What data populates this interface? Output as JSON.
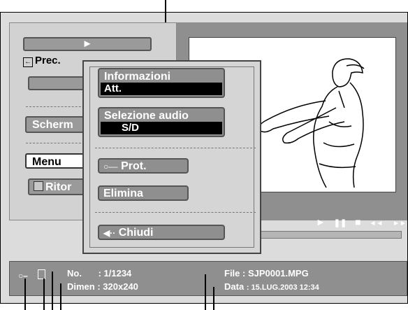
{
  "left_menu": {
    "play_arrow": "►",
    "prev_label": "Prec.",
    "screen_label": "Scherm",
    "menu_label": "Menu",
    "return_label": "Ritor"
  },
  "popup": {
    "info_title": "Informazioni",
    "info_value": "Att.",
    "audio_title": "Selezione audio",
    "audio_value": "S/D",
    "protect_icon": "key-icon",
    "protect_label": "Prot.",
    "delete_label": "Elimina",
    "close_label": "Chiudi"
  },
  "transport": {
    "play": "►",
    "pause": "❚❚",
    "stop": "■",
    "rewind": "◄◄",
    "forward": "►►"
  },
  "info_bar": {
    "no_label": "No.",
    "no_value": ": 1/1234",
    "dimen_label": "Dimen",
    "dimen_value": ": 320x240",
    "file_label": "File",
    "file_value": ": SJP0001.MPG",
    "data_label": "Data",
    "data_value": ": 15.LUG.2003 12:34"
  }
}
